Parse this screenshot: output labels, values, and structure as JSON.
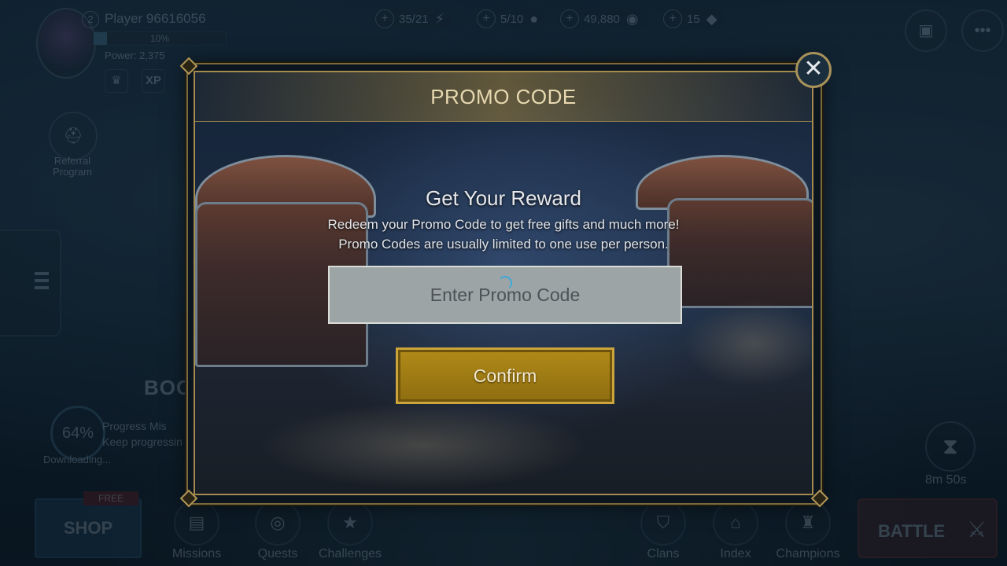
{
  "hud": {
    "level": "2",
    "player_name": "Player 96616056",
    "xp_percent": 10,
    "xp_label": "10%",
    "power": "Power: 2,375",
    "xp_badge": "XP",
    "resources": [
      {
        "value": "35/21",
        "icon": "lightning-icon",
        "glyph": "⚡"
      },
      {
        "value": "5/10",
        "icon": "key-icon",
        "glyph": "●"
      },
      {
        "value": "49,880",
        "icon": "silver-coin-icon",
        "glyph": "◉"
      },
      {
        "value": "15",
        "icon": "gem-icon",
        "glyph": "◆"
      }
    ],
    "referral_label": "Referral Program",
    "boost_text": "BOOS",
    "download_progress": "64%",
    "progress_mission_title": "Progress Mis",
    "progress_mission_sub": "Keep progressin",
    "downloading_label": "Downloading...",
    "timer": "8m 50s"
  },
  "bottom_nav": {
    "shop_label": "SHOP",
    "free_tag": "FREE",
    "items": [
      {
        "label": "Missions",
        "glyph": "▤"
      },
      {
        "label": "Quests",
        "glyph": "◎"
      },
      {
        "label": "Challenges",
        "glyph": "★"
      },
      {
        "label": "Clans",
        "glyph": "⛉"
      },
      {
        "label": "Index",
        "glyph": "⌂"
      },
      {
        "label": "Champions",
        "glyph": "♜"
      }
    ],
    "battle_label": "BATTLE"
  },
  "modal": {
    "title": "PROMO CODE",
    "reward_title": "Get Your Reward",
    "desc_line1": "Redeem your Promo Code to get free gifts and much more!",
    "desc_line2": "Promo Codes are usually limited to one use per person.",
    "input_placeholder": "Enter Promo Code",
    "input_value": "",
    "confirm_label": "Confirm",
    "close_glyph": "✕"
  }
}
